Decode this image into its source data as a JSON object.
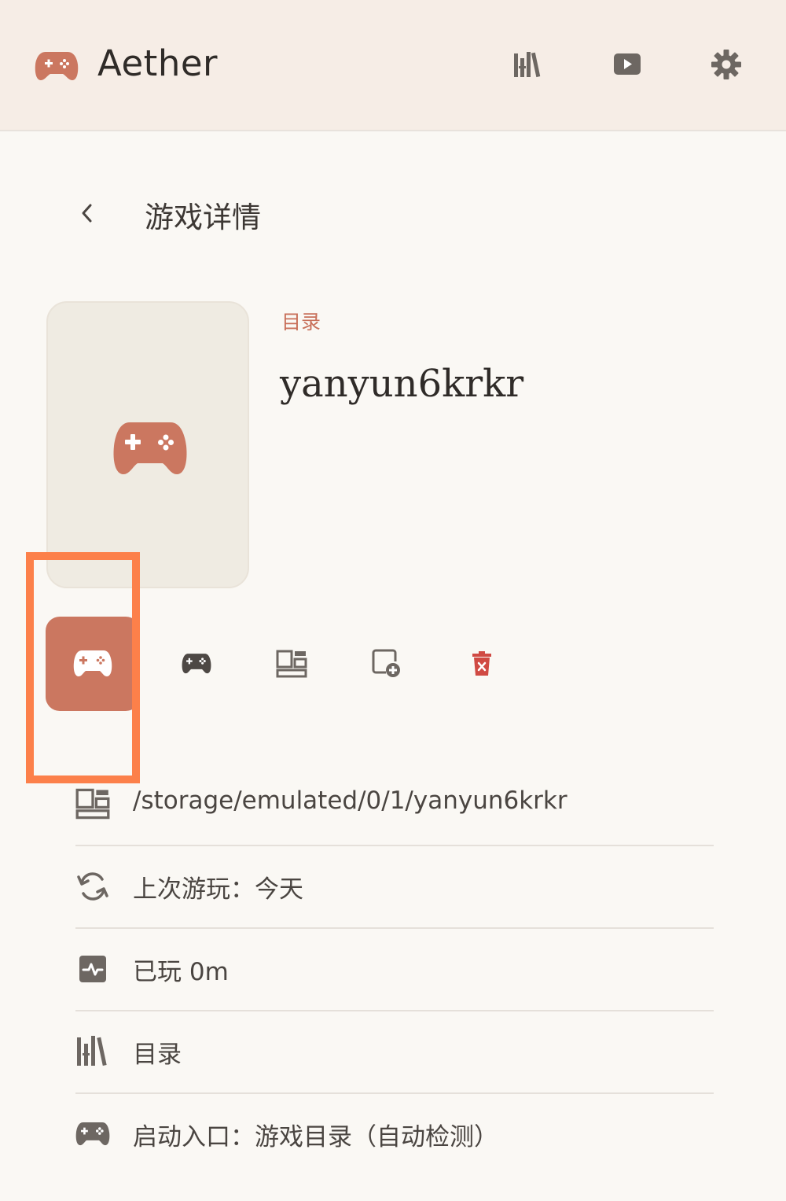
{
  "header": {
    "app_title": "Aether",
    "accent_color": "#cb7760",
    "buttons": [
      {
        "name": "library",
        "icon": "library-icon"
      },
      {
        "name": "play",
        "icon": "play-icon"
      },
      {
        "name": "settings",
        "icon": "gear-icon"
      }
    ]
  },
  "page": {
    "title": "游戏详情"
  },
  "game": {
    "category": "目录",
    "name": "yanyun6krkr",
    "cover_icon": "gamepad-icon"
  },
  "actions": [
    {
      "name": "launch-game",
      "icon": "gamepad-icon",
      "selected": true
    },
    {
      "name": "controller",
      "icon": "gamepad-icon"
    },
    {
      "name": "directory",
      "icon": "layout-icon"
    },
    {
      "name": "add-shortcut",
      "icon": "add-window-icon"
    },
    {
      "name": "delete",
      "icon": "trash-icon",
      "color": "#d04a43"
    }
  ],
  "info": {
    "path": "/storage/emulated/0/1/yanyun6krkr",
    "last_played": "上次游玩：今天",
    "played_time": "已玩 0m",
    "category": "目录",
    "launch_entry": "启动入口：游戏目录（自动检测）"
  }
}
